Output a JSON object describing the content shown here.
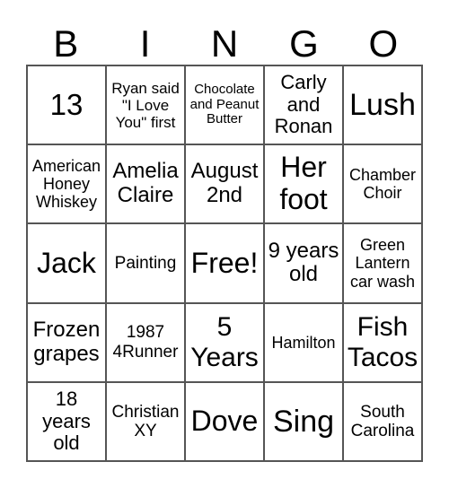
{
  "header": [
    "B",
    "I",
    "N",
    "G",
    "O"
  ],
  "cells": [
    "13",
    "Ryan said \"I Love You\" first",
    "Chocolate and Peanut Butter",
    "Carly and Ronan",
    "Lush",
    "American Honey Whiskey",
    "Amelia Claire",
    "August 2nd",
    "Her foot",
    "Chamber Choir",
    "Jack",
    "Painting",
    "Free!",
    "9 years old",
    "Green Lantern car wash",
    "Frozen grapes",
    "1987 4Runner",
    "5 Years",
    "Hamilton",
    "Fish Tacos",
    "18 years old",
    "Christian XY",
    "Dove",
    "Sing",
    "South Carolina"
  ]
}
